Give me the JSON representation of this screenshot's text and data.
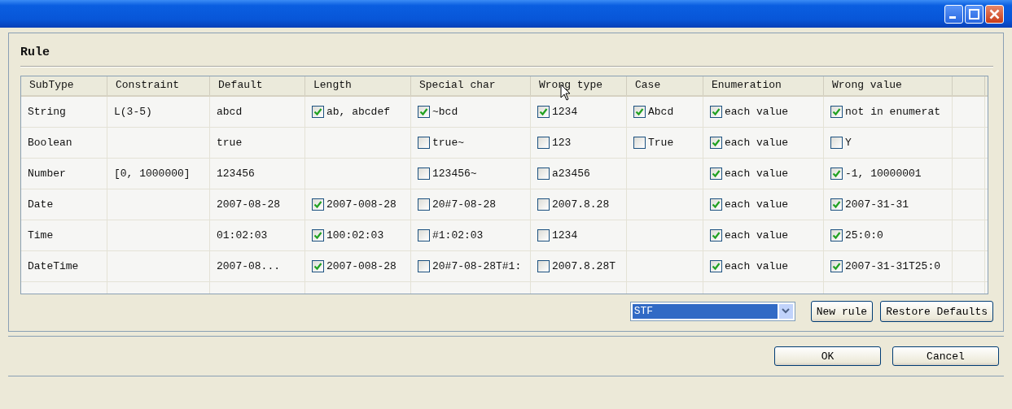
{
  "rule_panel": {
    "title": "Rule"
  },
  "table": {
    "columns": [
      "SubType",
      "Constraint",
      "Default",
      "Length",
      "Special char",
      "Wrong type",
      "Case",
      "Enumeration",
      "Wrong value"
    ],
    "rows": [
      [
        {
          "kind": "text",
          "text": "String"
        },
        {
          "kind": "text",
          "text": "L(3-5)"
        },
        {
          "kind": "text",
          "text": "abcd"
        },
        {
          "kind": "check",
          "text": "ab, abcdef",
          "checked": true
        },
        {
          "kind": "check",
          "text": "~bcd",
          "checked": true
        },
        {
          "kind": "check",
          "text": "1234",
          "checked": true
        },
        {
          "kind": "check",
          "text": "Abcd",
          "checked": true
        },
        {
          "kind": "check",
          "text": "each value",
          "checked": true
        },
        {
          "kind": "check",
          "text": "not in enumerat",
          "checked": true
        }
      ],
      [
        {
          "kind": "text",
          "text": "Boolean"
        },
        {
          "kind": "empty"
        },
        {
          "kind": "text",
          "text": "true"
        },
        {
          "kind": "empty"
        },
        {
          "kind": "check",
          "text": "true~",
          "checked": false
        },
        {
          "kind": "check",
          "text": "123",
          "checked": false
        },
        {
          "kind": "check",
          "text": "True",
          "checked": false
        },
        {
          "kind": "check",
          "text": "each value",
          "checked": true
        },
        {
          "kind": "check",
          "text": "Y",
          "checked": false
        }
      ],
      [
        {
          "kind": "text",
          "text": "Number"
        },
        {
          "kind": "text",
          "text": "[0, 1000000]"
        },
        {
          "kind": "text",
          "text": "123456"
        },
        {
          "kind": "empty"
        },
        {
          "kind": "check",
          "text": "123456~",
          "checked": false
        },
        {
          "kind": "check",
          "text": "a23456",
          "checked": false
        },
        {
          "kind": "empty"
        },
        {
          "kind": "check",
          "text": "each value",
          "checked": true
        },
        {
          "kind": "check",
          "text": "-1, 10000001",
          "checked": true
        }
      ],
      [
        {
          "kind": "text",
          "text": "Date"
        },
        {
          "kind": "empty"
        },
        {
          "kind": "text",
          "text": "2007-08-28"
        },
        {
          "kind": "check",
          "text": "2007-008-28",
          "checked": true
        },
        {
          "kind": "check",
          "text": "20#7-08-28",
          "checked": false
        },
        {
          "kind": "check",
          "text": "2007.8.28",
          "checked": false
        },
        {
          "kind": "empty"
        },
        {
          "kind": "check",
          "text": "each value",
          "checked": true
        },
        {
          "kind": "check",
          "text": "2007-31-31",
          "checked": true
        }
      ],
      [
        {
          "kind": "text",
          "text": "Time"
        },
        {
          "kind": "empty"
        },
        {
          "kind": "text",
          "text": "01:02:03"
        },
        {
          "kind": "check",
          "text": "100:02:03",
          "checked": true
        },
        {
          "kind": "check",
          "text": "#1:02:03",
          "checked": false
        },
        {
          "kind": "check",
          "text": "1234",
          "checked": false
        },
        {
          "kind": "empty"
        },
        {
          "kind": "check",
          "text": "each value",
          "checked": true
        },
        {
          "kind": "check",
          "text": "25:0:0",
          "checked": true
        }
      ],
      [
        {
          "kind": "text",
          "text": "DateTime"
        },
        {
          "kind": "empty"
        },
        {
          "kind": "text",
          "text": "2007-08..."
        },
        {
          "kind": "check",
          "text": "2007-008-28",
          "checked": true
        },
        {
          "kind": "check",
          "text": "20#7-08-28T#1:",
          "checked": false
        },
        {
          "kind": "check",
          "text": "2007.8.28T",
          "checked": false
        },
        {
          "kind": "empty"
        },
        {
          "kind": "check",
          "text": "each value",
          "checked": true
        },
        {
          "kind": "check",
          "text": "2007-31-31T25:0",
          "checked": true
        }
      ]
    ]
  },
  "rule_select": {
    "value": "STF"
  },
  "rule_buttons": [
    "New rule",
    "Restore Defaults"
  ],
  "dialog_buttons": [
    "OK",
    "Cancel"
  ]
}
